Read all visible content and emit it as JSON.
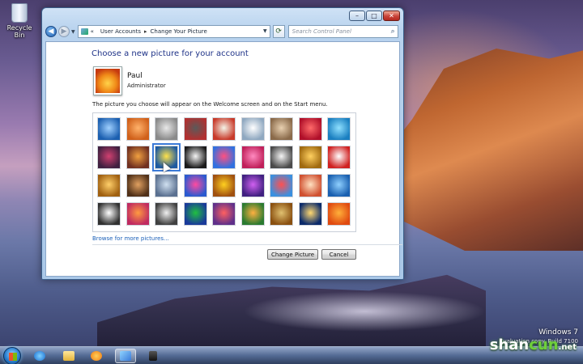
{
  "desktop": {
    "recycle_bin_label": "Recycle Bin",
    "windows_version": "Windows 7",
    "evaluation_text": "Evaluation copy. Build 7100",
    "brand_prefix": "shan",
    "brand_suffix": "cun",
    "brand_tld": ".net"
  },
  "window": {
    "caption_buttons": {
      "minimize": "–",
      "maximize": "□",
      "close": "✕"
    },
    "nav": {
      "breadcrumb": [
        "User Accounts",
        "Change Your Picture"
      ],
      "breadcrumb_prefix": "«",
      "separator": "▸",
      "search_placeholder": "Search Control Panel"
    },
    "page_title": "Choose a new picture for your account",
    "user": {
      "name": "Paul",
      "role": "Administrator"
    },
    "description": "The picture you choose will appear on the Welcome screen and on the Start menu.",
    "browse_link": "Browse for more pictures...",
    "buttons": {
      "change": "Change Picture",
      "cancel": "Cancel"
    }
  },
  "pictures": {
    "columns": 9,
    "rows": 4,
    "selected_index": 11,
    "tiles": [
      {
        "name": "abstract-blue",
        "colors": [
          "#9fd0ff",
          "#1b5fb0"
        ]
      },
      {
        "name": "starfish",
        "colors": [
          "#ffb26b",
          "#d0601a"
        ]
      },
      {
        "name": "robot",
        "colors": [
          "#e8e8e8",
          "#8a8a8a"
        ]
      },
      {
        "name": "vinyl",
        "colors": [
          "#5a5a5a",
          "#b23030"
        ]
      },
      {
        "name": "lucky-cat",
        "colors": [
          "#f4f4e8",
          "#c83a2a"
        ]
      },
      {
        "name": "satellite-dish",
        "colors": [
          "#ffffff",
          "#8fa8c0"
        ]
      },
      {
        "name": "shells",
        "colors": [
          "#e8d0b0",
          "#8a6a4a"
        ]
      },
      {
        "name": "flower-red",
        "colors": [
          "#ff6a6a",
          "#b0102a"
        ]
      },
      {
        "name": "pinwheel",
        "colors": [
          "#8fe0ff",
          "#1a7fc0"
        ]
      },
      {
        "name": "ball",
        "colors": [
          "#d04070",
          "#402040"
        ]
      },
      {
        "name": "stripes",
        "colors": [
          "#f0a040",
          "#703020"
        ]
      },
      {
        "name": "leaf-yellow",
        "colors": [
          "#ffe24a",
          "#1e5aa0"
        ]
      },
      {
        "name": "dog",
        "colors": [
          "#f4f4f4",
          "#1a1a1a"
        ]
      },
      {
        "name": "crayons",
        "colors": [
          "#ff5080",
          "#3070e0"
        ]
      },
      {
        "name": "pink-star",
        "colors": [
          "#ff8ac0",
          "#c0205a"
        ]
      },
      {
        "name": "jacks",
        "colors": [
          "#f4f4f4",
          "#4a4a4a"
        ]
      },
      {
        "name": "golden-steps",
        "colors": [
          "#ffd060",
          "#a06a10"
        ]
      },
      {
        "name": "origami",
        "colors": [
          "#ffffff",
          "#d02020"
        ]
      },
      {
        "name": "guitar",
        "colors": [
          "#ffcf6a",
          "#a06010"
        ]
      },
      {
        "name": "puppy",
        "colors": [
          "#e0a060",
          "#503018"
        ]
      },
      {
        "name": "toy-robot",
        "colors": [
          "#d0e0f0",
          "#5a7090"
        ]
      },
      {
        "name": "color-swirl",
        "colors": [
          "#ff4aa0",
          "#2a5ad0"
        ]
      },
      {
        "name": "sunflower",
        "colors": [
          "#ffd020",
          "#a05010"
        ]
      },
      {
        "name": "purple-flower",
        "colors": [
          "#d060f0",
          "#402080"
        ]
      },
      {
        "name": "balloon",
        "colors": [
          "#ff5050",
          "#3a90e0"
        ]
      },
      {
        "name": "doll",
        "colors": [
          "#ffe0c0",
          "#d05030"
        ]
      },
      {
        "name": "sailboat",
        "colors": [
          "#8fd0ff",
          "#1a60b0"
        ]
      },
      {
        "name": "soccer-ball",
        "colors": [
          "#ffffff",
          "#303030"
        ]
      },
      {
        "name": "blocks",
        "colors": [
          "#ff9a40",
          "#c02a60"
        ]
      },
      {
        "name": "chess",
        "colors": [
          "#f0f0f0",
          "#404040"
        ]
      },
      {
        "name": "window-frame",
        "colors": [
          "#20c040",
          "#1a3a9a"
        ]
      },
      {
        "name": "patterns",
        "colors": [
          "#ff6060",
          "#60308a"
        ]
      },
      {
        "name": "butterfly",
        "colors": [
          "#ffb040",
          "#2a7a30"
        ]
      },
      {
        "name": "spiral",
        "colors": [
          "#e0c070",
          "#8a5010"
        ]
      },
      {
        "name": "lantern",
        "colors": [
          "#ffd870",
          "#0a2a6a"
        ]
      },
      {
        "name": "orange-flower",
        "colors": [
          "#ffb03a",
          "#e04a10"
        ]
      }
    ]
  },
  "taskbar": {
    "items": [
      {
        "name": "internet-explorer-icon",
        "glyph": "g-ie"
      },
      {
        "name": "folder-icon",
        "glyph": "g-folder"
      },
      {
        "name": "media-player-icon",
        "glyph": "g-media"
      },
      {
        "name": "control-panel-icon",
        "glyph": "g-cpanel",
        "active": true
      },
      {
        "name": "speaker-icon",
        "glyph": "g-speaker"
      }
    ]
  }
}
